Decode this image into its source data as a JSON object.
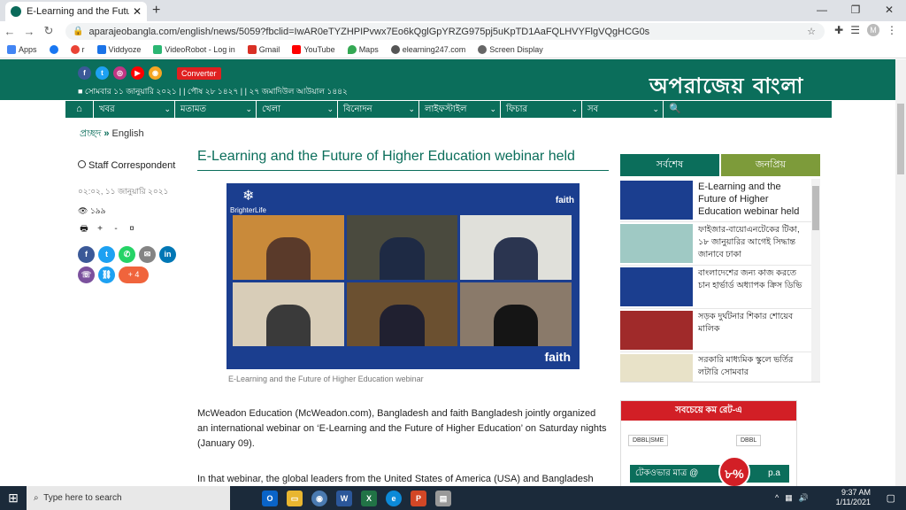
{
  "browser": {
    "tab_title": "E-Learning and the Future of High",
    "new_tab": "+",
    "url": "aparajeobangla.com/english/news/5059?fbclid=IwAR0eTYZHPIPvwx7Eo6kQglGpYRZG975pj5uKpTD1AaFQLHVYFlgVQgHCG0s",
    "profile_initial": "M",
    "bookmarks": [
      "Apps",
      "r",
      "Viddyoze",
      "VideoRobot - Log in",
      "Gmail",
      "YouTube",
      "Maps",
      "elearning247.com",
      "Screen Display"
    ],
    "bookmark_colors": [
      "#4285f4",
      "#1877f2",
      "#ea4335",
      "#1a73e8",
      "#2bb673",
      "#d93025",
      "#ff0000",
      "#34a853",
      "#555555",
      "#666666"
    ]
  },
  "site": {
    "converter": "Converter",
    "dateline": "■ সোমবার ১১ জানুয়ারি ২০২১ | | পৌষ ২৮ ১৪২৭ | | ২৭ জমাদিউল আউয়াল ১৪৪২",
    "logo": "অপরাজেয় বাংলা",
    "social_colors": [
      "#3b5998",
      "#1da1f2",
      "#c13584",
      "#ff0000",
      "#f5a623"
    ],
    "menu": [
      "খবর",
      "মতামত",
      "খেলা",
      "বিনোদন",
      "লাইফস্টাইল",
      "ফিচার",
      "সব"
    ]
  },
  "breadcrumb": {
    "home": "প্রচ্ছদ",
    "arrows": "»",
    "section": "English"
  },
  "article": {
    "author": "Staff Correspondent",
    "published": "০২:০২, ১১ জানুয়ারি ২০২১",
    "views": "১৯৯",
    "share_more": "+ 4",
    "headline": "E-Learning and the Future of Higher Education webinar held",
    "photo_brand_left": "BrighterLife",
    "photo_brand_right": "faith",
    "caption": "E-Learning and the Future of Higher Education webinar",
    "paragraphs": [
      "McWeadon Education (McWeadon.com), Bangladesh and faith Bangladesh jointly organized an international webinar on ‘E-Learning and the Future of Higher Education’ on Saturday nights (January 09).",
      "In that webinar, the global leaders from the United States of America (USA) and Bangladesh"
    ]
  },
  "sidebar": {
    "tab_latest": "সর্বশেষ",
    "tab_popular": "জনপ্রিয়",
    "items": [
      {
        "text": "E-Learning and the Future of Higher Education webinar held"
      },
      {
        "text": "ফাইজার-বায়োএনটেকের টিকা, ১৮ জানুয়ারির আগেই সিদ্ধান্ত জানাবে ঢাকা"
      },
      {
        "text": "বাংলাদেশের জন্য কাজ করতে চান হার্ভার্ড অধ্যাপক ক্রিস ডিভি"
      },
      {
        "text": "সড়ক দুর্ঘটনার শিকার শোয়েব মালিক"
      },
      {
        "text": "সরকারি মাধ্যমিক স্কুলে ভর্তির লটারি সোমবার"
      }
    ]
  },
  "ad": {
    "headline": "সবচেয়ে কম রেট-এ",
    "bank1": "DBBL|SME",
    "bank2": "DBBL",
    "rate_text": "টেকওভার মাত্র @",
    "rate_value": "৮%",
    "rate_suffix": "p.a"
  },
  "taskbar": {
    "search_placeholder": "Type here to search",
    "time": "9:37 AM",
    "date": "1/11/2021"
  }
}
